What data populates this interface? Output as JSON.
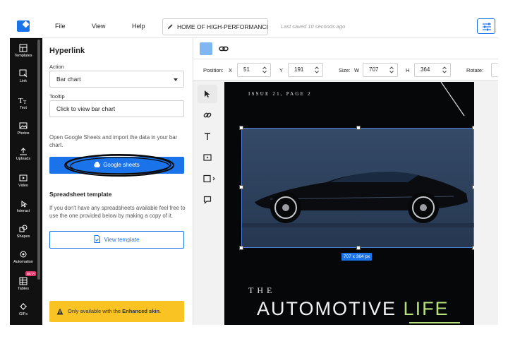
{
  "header": {
    "menu": [
      "File",
      "View",
      "Help"
    ],
    "doc_title": "HOME OF HIGH-PERFORMANCE...",
    "saved_status": "Last saved 10 seconds ago"
  },
  "rail": {
    "items": [
      {
        "label": "Templates",
        "icon": "templates-icon"
      },
      {
        "label": "Link",
        "icon": "link-icon"
      },
      {
        "label": "Text",
        "icon": "text-icon"
      },
      {
        "label": "Photos",
        "icon": "photos-icon"
      },
      {
        "label": "Uploads",
        "icon": "uploads-icon"
      },
      {
        "label": "Video",
        "icon": "video-icon"
      },
      {
        "label": "Interact",
        "icon": "interact-icon"
      },
      {
        "label": "Shapes",
        "icon": "shapes-icon"
      },
      {
        "label": "Automation",
        "icon": "automation-icon"
      },
      {
        "label": "Tables",
        "icon": "tables-icon"
      },
      {
        "label": "GIFs",
        "icon": "gifs-icon"
      }
    ],
    "beta_badge": "BETA"
  },
  "panel": {
    "title": "Hyperlink",
    "action_label": "Action",
    "action_value": "Bar chart",
    "tooltip_label": "Tooltip",
    "tooltip_value": "Click to view bar chart",
    "description": "Open Google Sheets and import the data in your bar chart.",
    "google_sheets_button": "Google sheets",
    "template_heading": "Spreadsheet template",
    "template_description": "If you don't have any spreadsheets available feel free to use the one provided below by making a copy of it.",
    "view_template_button": "View template",
    "warning_prefix": "Only available with the ",
    "warning_strong": "Enhanced skin",
    "warning_suffix": "."
  },
  "toolbar": {
    "swatch_color": "#80b7f2",
    "position_label": "Position:",
    "x_label": "X",
    "x_value": "51",
    "y_label": "Y",
    "y_value": "191",
    "size_label": "Size:",
    "w_label": "W",
    "w_value": "707",
    "h_label": "H",
    "h_value": "364",
    "rotate_label": "Rotate:"
  },
  "canvas": {
    "issue_text": "ISSUE 21, PAGE 2",
    "dimension_badge": "707 x 364 px",
    "the_text": "THE",
    "automotive_text": "AUTOMOTIVE",
    "life_text": "LIFE"
  },
  "colors": {
    "accent": "#1a73e8",
    "warning": "#f9c324",
    "canvas_bg": "#060709",
    "life_green": "#b6e07a"
  }
}
